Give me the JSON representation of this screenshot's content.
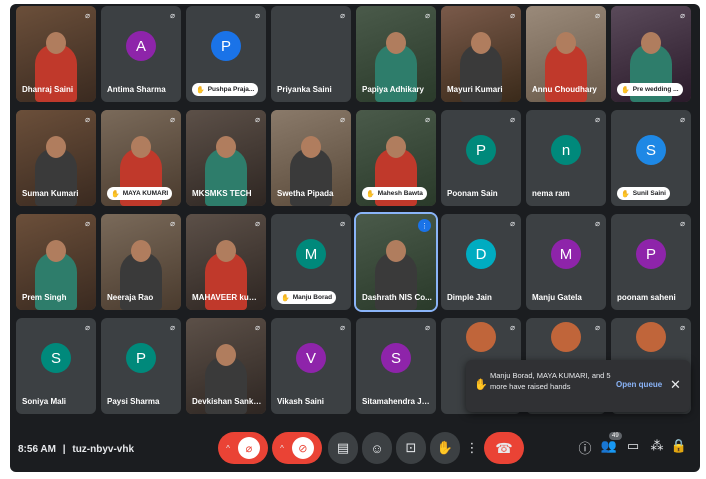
{
  "participants": [
    {
      "name": "Dhanraj Saini",
      "type": "video"
    },
    {
      "name": "Antima Sharma",
      "type": "avatar",
      "initial": "A",
      "color": "#8e24aa"
    },
    {
      "name": "Pushpa Praja...",
      "type": "avatar",
      "initial": "P",
      "color": "#1a73e8",
      "raised_hand": true
    },
    {
      "name": "Priyanka Saini",
      "type": "blank"
    },
    {
      "name": "Papiya Adhikary",
      "type": "video"
    },
    {
      "name": "Mayuri Kumari",
      "type": "video"
    },
    {
      "name": "Annu Choudhary",
      "type": "video"
    },
    {
      "name": "Pre wedding ...",
      "type": "video",
      "raised_hand": true
    },
    {
      "name": "Suman Kumari",
      "type": "video"
    },
    {
      "name": "MAYA KUMARI",
      "type": "video",
      "raised_hand": true
    },
    {
      "name": "MKSMKS TECH",
      "type": "video"
    },
    {
      "name": "Swetha Pipada",
      "type": "video"
    },
    {
      "name": "Mahesh Bawta",
      "type": "video",
      "raised_hand": true
    },
    {
      "name": "Poonam Sain",
      "type": "avatar",
      "initial": "P",
      "color": "#00897b"
    },
    {
      "name": "nema ram",
      "type": "avatar",
      "initial": "n",
      "color": "#00897b"
    },
    {
      "name": "Sunil Saini",
      "type": "avatar",
      "initial": "S",
      "color": "#1e88e5",
      "raised_hand": true
    },
    {
      "name": "Prem Singh",
      "type": "video"
    },
    {
      "name": "Neeraja Rao",
      "type": "video"
    },
    {
      "name": "MAHAVEER kum...",
      "type": "video"
    },
    {
      "name": "Manju Borad",
      "type": "avatar",
      "initial": "M",
      "color": "#00897b",
      "raised_hand": true
    },
    {
      "name": "Dashrath NIS Co...",
      "type": "video",
      "speaking": true
    },
    {
      "name": "Dimple Jain",
      "type": "avatar",
      "initial": "D",
      "color": "#00acc1"
    },
    {
      "name": "Manju Gatela",
      "type": "avatar",
      "initial": "M",
      "color": "#8e24aa"
    },
    {
      "name": "poonam saheni",
      "type": "avatar",
      "initial": "P",
      "color": "#8e24aa"
    },
    {
      "name": "Soniya Mali",
      "type": "avatar",
      "initial": "S",
      "color": "#00897b"
    },
    {
      "name": "Paysi Sharma",
      "type": "avatar",
      "initial": "P",
      "color": "#00897b"
    },
    {
      "name": "Devkishan Sankhla",
      "type": "video"
    },
    {
      "name": "Vikash Saini",
      "type": "avatar",
      "initial": "V",
      "color": "#8e24aa"
    },
    {
      "name": "Sitamahendra Ja...",
      "type": "avatar",
      "initial": "S",
      "color": "#8e24aa"
    },
    {
      "name": "",
      "type": "partial"
    },
    {
      "name": "",
      "type": "partial"
    },
    {
      "name": "",
      "type": "partial"
    }
  ],
  "meeting": {
    "time": "8:56 AM",
    "separator": "|",
    "code": "tuz-nbyv-vhk"
  },
  "controls": {
    "people_count": "49"
  },
  "notification": {
    "message": "Manju Borad, MAYA KUMARI, and 5 more have raised hands",
    "action": "Open queue",
    "close": "✕"
  },
  "colors": {
    "background": "#1b1d20",
    "tile": "#3c4043",
    "accent": "#8ab4f8",
    "danger": "#ea4335"
  },
  "icons": {
    "mic_off": "microphone-off-icon",
    "cam_off": "camera-off-icon",
    "captions": "captions-icon",
    "emoji": "emoji-icon",
    "present": "present-icon",
    "raise_hand": "raise-hand-icon",
    "more": "more-options-icon",
    "end_call": "end-call-icon",
    "info": "info-icon",
    "people": "people-icon",
    "chat": "chat-icon",
    "activities": "activities-icon",
    "lock": "host-controls-icon"
  }
}
